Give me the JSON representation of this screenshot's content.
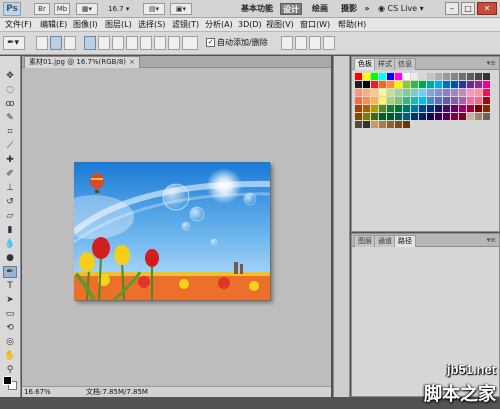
{
  "titlebar": {
    "logo": "Ps",
    "br": "Br",
    "mb": "Mb",
    "zoom": "16.7",
    "workspaces": [
      "基本功能",
      "设计",
      "绘画",
      "摄影"
    ],
    "more": "»",
    "cslive": "CS Live ▾",
    "win_min": "–",
    "win_max": "□",
    "win_close": "✕"
  },
  "menu": [
    "文件(F)",
    "编辑(E)",
    "图像(I)",
    "图层(L)",
    "选择(S)",
    "滤镜(T)",
    "分析(A)",
    "3D(D)",
    "视图(V)",
    "窗口(W)",
    "帮助(H)"
  ],
  "options": {
    "auto_add_delete": "自动添加/删除",
    "auto_add_delete_checked": true
  },
  "document": {
    "tab_title": "素材01.jpg @ 16.7%(RGB/8)",
    "tab_close": "×",
    "zoom_status": "16.67%",
    "doc_status": "文档:7.85M/7.85M"
  },
  "panel_top": {
    "tabs": [
      "色板",
      "样式",
      "信息"
    ],
    "active_tab": "色板",
    "menu": "▾≡"
  },
  "panel_bottom": {
    "tabs": [
      "图层",
      "通道",
      "路径"
    ],
    "active_tab": "路径",
    "menu": "▾≡"
  },
  "watermark": {
    "line1": "jb51.net",
    "line2": "脚本之家"
  },
  "tools": [
    "move-tool",
    "marquee-tool",
    "lasso-tool",
    "quick-select-tool",
    "crop-tool",
    "eyedropper-tool",
    "healing-brush-tool",
    "brush-tool",
    "clone-stamp-tool",
    "history-brush-tool",
    "eraser-tool",
    "gradient-tool",
    "blur-tool",
    "dodge-tool",
    "pen-tool",
    "type-tool",
    "path-select-tool",
    "shape-tool",
    "3d-rotate-tool",
    "3d-orbit-tool",
    "hand-tool",
    "zoom-tool"
  ],
  "colors": {
    "selected_tool_bg": "#9fb4cc",
    "doc_area_bg": "#bdbdbd",
    "ui_chrome": "#d6d6d6"
  }
}
